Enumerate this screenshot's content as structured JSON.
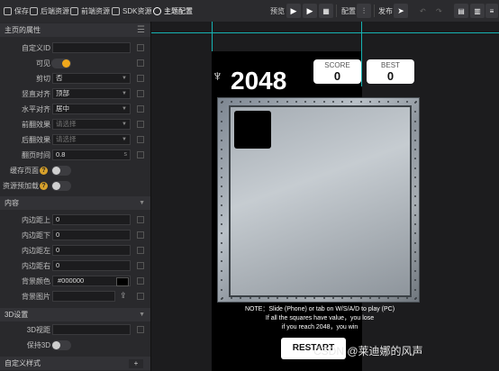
{
  "toolbar": {
    "left": [
      {
        "label": "保存",
        "icon": "save-icon"
      },
      {
        "label": "后端资源",
        "icon": "folder-icon"
      },
      {
        "label": "前端资源",
        "icon": "folder-icon"
      },
      {
        "label": "SDK资源",
        "icon": "folder-icon"
      },
      {
        "label": "主题配置",
        "icon": "palette-icon"
      }
    ],
    "preview": "预览",
    "config": "配置",
    "publish": "发布"
  },
  "panel": {
    "section1": "主页的属性",
    "rows1": [
      {
        "label": "自定义ID",
        "value": ""
      },
      {
        "label": "可见"
      },
      {
        "label": "剪切",
        "value": "否"
      },
      {
        "label": "竖直对齐",
        "value": "顶部"
      },
      {
        "label": "水平对齐",
        "value": "居中"
      },
      {
        "label": "前翻效果",
        "placeholder": "请选择"
      },
      {
        "label": "后翻效果",
        "placeholder": "请选择"
      },
      {
        "label": "翻页时间",
        "value": "0.8",
        "unit": "s"
      },
      {
        "label": "缓存页面"
      },
      {
        "label": "资源预加载"
      }
    ],
    "section2": "内容",
    "rows2": [
      {
        "label": "内边距上",
        "value": "0"
      },
      {
        "label": "内边距下",
        "value": "0"
      },
      {
        "label": "内边距左",
        "value": "0"
      },
      {
        "label": "内边距右",
        "value": "0"
      },
      {
        "label": "背景颜色",
        "value": "#000000"
      },
      {
        "label": "背景图片",
        "value": ""
      }
    ],
    "section3": "3D设置",
    "rows3": [
      {
        "label": "3D视距",
        "value": ""
      },
      {
        "label": "保持3D"
      }
    ],
    "section4": "自定义样式",
    "add": "+"
  },
  "game": {
    "title": "2048",
    "score_label": "SCORE",
    "score": "0",
    "best_label": "BEST",
    "best": "0",
    "note1": "NOTE：Slide (Phone) or tab on W/S/A/D to play (PC)",
    "note2": "If all the squares have value，you lose",
    "note3": "if you reach 2048，you win",
    "restart": "RESTART"
  },
  "watermark": "CSDN @莱迪娜的风声"
}
